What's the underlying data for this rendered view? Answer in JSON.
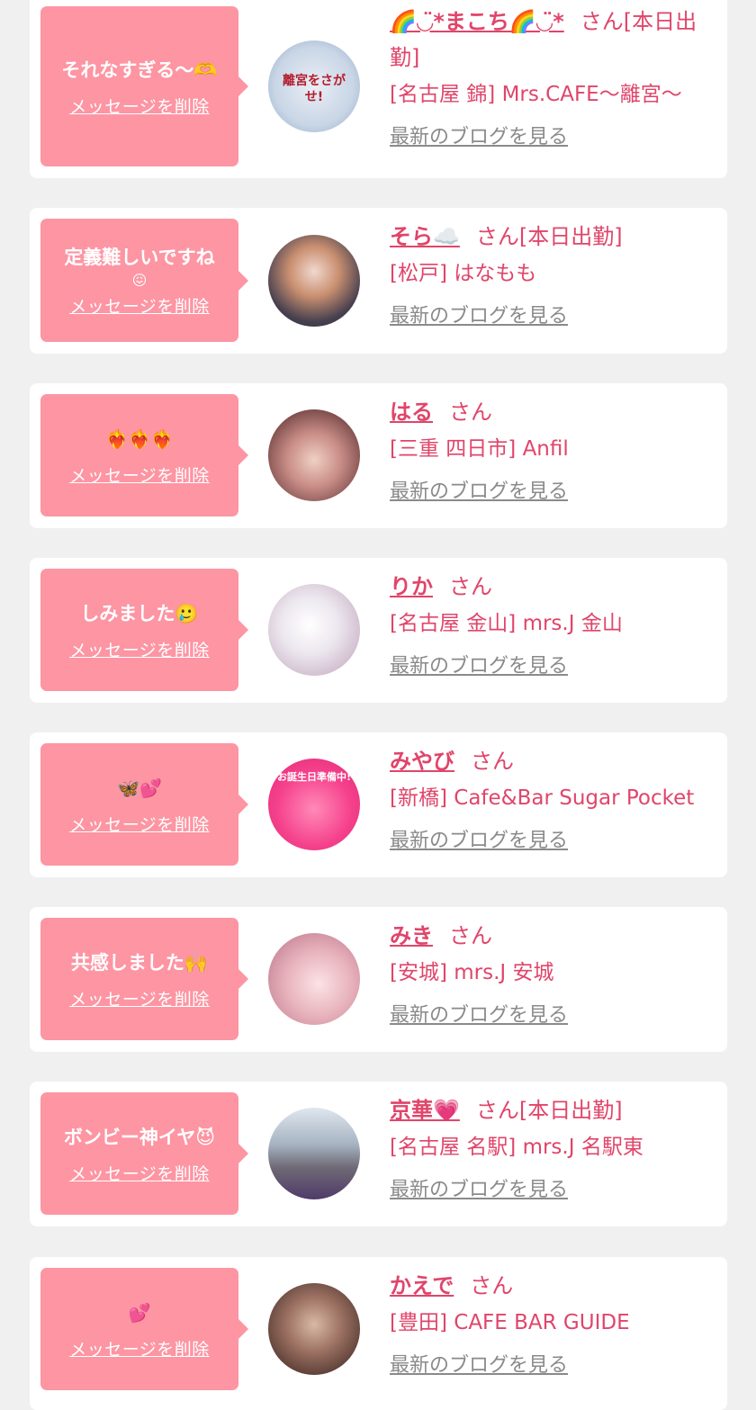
{
  "colors": {
    "accent": "#e0456a",
    "bubble": "#fd95a3",
    "background": "#f1f0f1"
  },
  "delete_label": "メッセージを削除",
  "blog_label": "最新のブログを見る",
  "san_label": "さん",
  "items": [
    {
      "message": "それなすぎる〜🫶",
      "message_emoji": "",
      "name": "🌈◡̈*まこち🌈◡̈*",
      "status": "[本日出勤]",
      "shop": "[名古屋 錦] Mrs.CAFE〜離宮〜",
      "avatar_text": "離宮をさがせ!"
    },
    {
      "message": "定義難しいですね",
      "message_emoji": "😖",
      "name": "そら☁️",
      "status": "[本日出勤]",
      "shop": "[松戸] はなもも",
      "avatar_text": ""
    },
    {
      "message": "❤️‍🔥❤️‍🔥❤️‍🔥",
      "message_emoji": "",
      "name": "はる",
      "status": "",
      "shop": "[三重 四日市] Anfil",
      "avatar_text": ""
    },
    {
      "message": "しみました🥲",
      "message_emoji": "",
      "name": "りか",
      "status": "",
      "shop": "[名古屋 金山] mrs.J 金山",
      "avatar_text": ""
    },
    {
      "message": "🦋💕",
      "message_emoji": "",
      "name": "みやび",
      "status": "",
      "shop": "[新橋] Cafe&Bar Sugar Pocket",
      "avatar_text": "お誕生日準備中!"
    },
    {
      "message": "共感しました🙌",
      "message_emoji": "",
      "name": "みき",
      "status": "",
      "shop": "[安城] mrs.J 安城",
      "avatar_text": ""
    },
    {
      "message": "ボンビー神イヤ😈",
      "message_emoji": "",
      "name": "京華💗",
      "status": "[本日出勤]",
      "shop": "[名古屋 名駅] mrs.J 名駅東",
      "avatar_text": ""
    },
    {
      "message": "💕",
      "message_emoji": "",
      "name": "かえで",
      "status": "",
      "shop": "[豊田] CAFE BAR GUIDE",
      "avatar_text": ""
    }
  ]
}
